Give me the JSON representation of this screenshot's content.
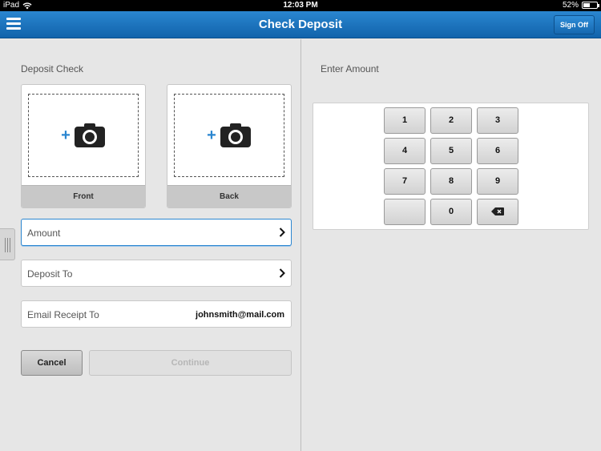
{
  "status_bar": {
    "device": "iPad",
    "time": "12:03 PM",
    "battery": "52%",
    "battery_level": 0.52,
    "icons": [
      "wifi-icon",
      "battery-icon"
    ]
  },
  "header": {
    "title": "Check Deposit",
    "sign_off_label": "Sign Off",
    "menu_icon": "hamburger-menu-icon",
    "accent_color": "#1a73bf"
  },
  "deposit": {
    "section_label": "Deposit Check",
    "front_label": "Front",
    "back_label": "Back",
    "capture_icon": "camera-plus-icon",
    "amount_label": "Amount",
    "deposit_to_label": "Deposit To",
    "email_label": "Email Receipt To",
    "email_value": "johnsmith@mail.com",
    "cancel_label": "Cancel",
    "continue_label": "Continue"
  },
  "keypad": {
    "section_label": "Enter Amount",
    "keys": [
      "1",
      "2",
      "3",
      "4",
      "5",
      "6",
      "7",
      "8",
      "9",
      "",
      "0"
    ],
    "backspace_icon": "backspace-icon"
  }
}
